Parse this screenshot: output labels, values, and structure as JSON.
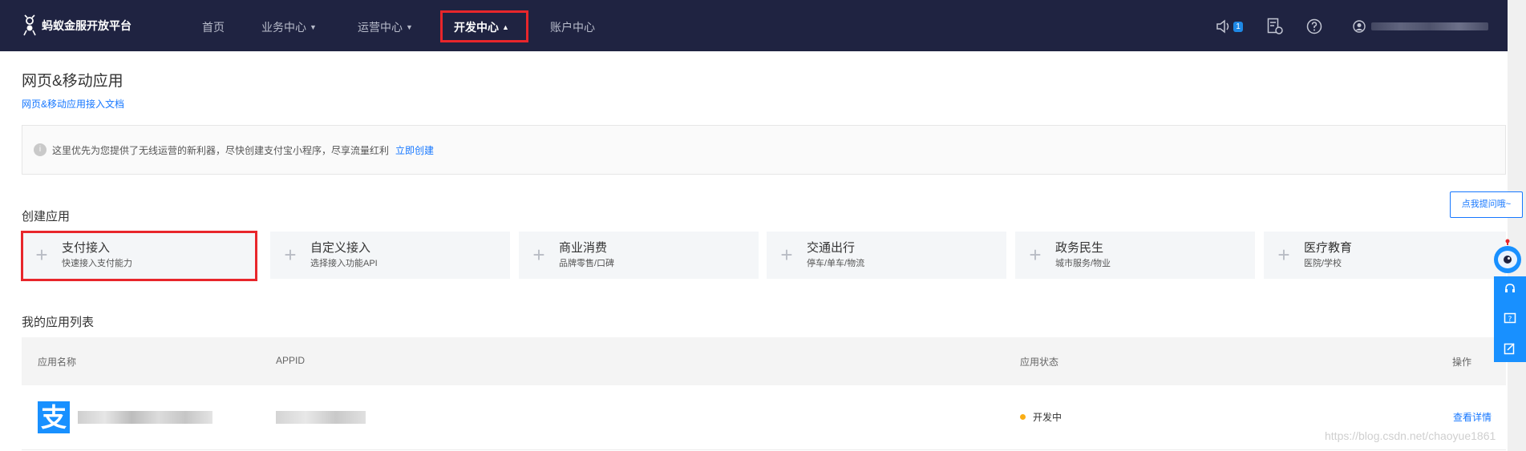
{
  "header": {
    "logo_text": "蚂蚁金服开放平台",
    "nav": [
      {
        "label": "首页",
        "has_caret": false
      },
      {
        "label": "业务中心",
        "has_caret": true
      },
      {
        "label": "运营中心",
        "has_caret": true
      },
      {
        "label": "开发中心",
        "has_caret": true,
        "active": true
      },
      {
        "label": "账户中心",
        "has_caret": false
      }
    ],
    "notification_count": "1"
  },
  "page": {
    "title": "网页&移动应用",
    "doc_link": "网页&移动应用接入文档"
  },
  "notice": {
    "icon": "i",
    "text": "这里优先为您提供了无线运营的新利器，尽快创建支付宝小程序，尽享流量红利",
    "link": "立即创建"
  },
  "create": {
    "title": "创建应用",
    "cards": [
      {
        "title": "支付接入",
        "subtitle": "快速接入支付能力"
      },
      {
        "title": "自定义接入",
        "subtitle": "选择接入功能API"
      },
      {
        "title": "商业消费",
        "subtitle": "品牌零售/口碑"
      },
      {
        "title": "交通出行",
        "subtitle": "停车/单车/物流"
      },
      {
        "title": "政务民生",
        "subtitle": "城市服务/物业"
      },
      {
        "title": "医疗教育",
        "subtitle": "医院/学校"
      }
    ]
  },
  "apps": {
    "title": "我的应用列表",
    "columns": [
      "应用名称",
      "APPID",
      "应用状态",
      "操作"
    ],
    "rows": [
      {
        "logo_char": "支",
        "status": "开发中",
        "action": "查看详情"
      }
    ]
  },
  "widget": {
    "bubble": "点我提问哦~"
  },
  "watermark": "https://blog.csdn.net/chaoyue1861",
  "colors": {
    "nav_bg": "#1f2341",
    "accent": "#1677ff",
    "highlight": "#e8262b",
    "status_dev": "#faad14"
  }
}
